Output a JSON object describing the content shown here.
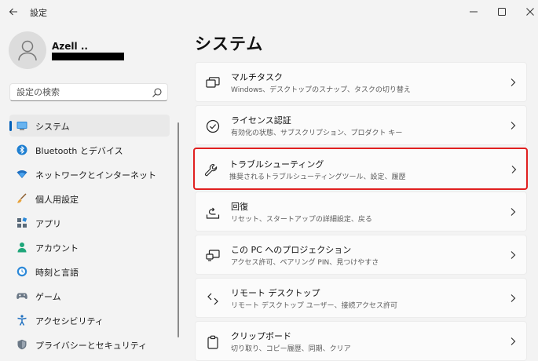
{
  "window": {
    "title": "設定"
  },
  "user": {
    "name": "Azell .."
  },
  "search": {
    "placeholder": "設定の検索"
  },
  "sidebar": {
    "items": [
      {
        "label": "システム",
        "icon": "system-icon",
        "active": true
      },
      {
        "label": "Bluetooth とデバイス",
        "icon": "bluetooth-icon"
      },
      {
        "label": "ネットワークとインターネット",
        "icon": "network-icon"
      },
      {
        "label": "個人用設定",
        "icon": "personalization-icon"
      },
      {
        "label": "アプリ",
        "icon": "apps-icon"
      },
      {
        "label": "アカウント",
        "icon": "accounts-icon"
      },
      {
        "label": "時刻と言語",
        "icon": "time-language-icon"
      },
      {
        "label": "ゲーム",
        "icon": "gaming-icon"
      },
      {
        "label": "アクセシビリティ",
        "icon": "accessibility-icon"
      },
      {
        "label": "プライバシーとセキュリティ",
        "icon": "privacy-security-icon"
      }
    ]
  },
  "main": {
    "title": "システム",
    "cards": [
      {
        "title": "マルチタスク",
        "subtitle": "Windows、デスクトップのスナップ、タスクの切り替え",
        "icon": "multitasking-icon"
      },
      {
        "title": "ライセンス認証",
        "subtitle": "有効化の状態、サブスクリプション、プロダクト キー",
        "icon": "activation-icon"
      },
      {
        "title": "トラブルシューティング",
        "subtitle": "推奨されるトラブルシューティングツール、設定、履歴",
        "icon": "wrench-icon",
        "highlighted": true
      },
      {
        "title": "回復",
        "subtitle": "リセット、スタートアップの詳細設定、戻る",
        "icon": "recovery-icon"
      },
      {
        "title": "この PC へのプロジェクション",
        "subtitle": "アクセス許可、ペアリング PIN、見つけやすさ",
        "icon": "projection-icon"
      },
      {
        "title": "リモート デスクトップ",
        "subtitle": "リモート デスクトップ ユーザー、接続アクセス許可",
        "icon": "remote-desktop-icon"
      },
      {
        "title": "クリップボード",
        "subtitle": "切り取り、コピー履歴、同期、クリア",
        "icon": "clipboard-icon"
      }
    ]
  },
  "colors": {
    "accent": "#005fb8",
    "highlight_border": "#e02020",
    "background": "#f3f3f3"
  }
}
